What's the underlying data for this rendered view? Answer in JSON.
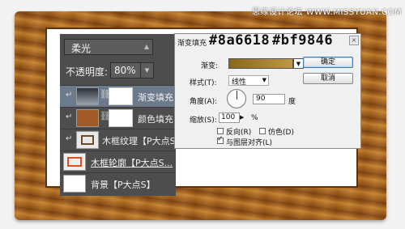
{
  "watermark": "思缘设计论坛 WWW.MISSYUAN.COM",
  "layers_panel": {
    "blend_mode": "柔光",
    "opacity_label": "不透明度:",
    "opacity_value": "80%",
    "layers": [
      {
        "name": "渐变填充 ...",
        "clipped": true,
        "selected": true,
        "thumb": "gradient"
      },
      {
        "name": "颜色填充 ...",
        "clipped": true,
        "selected": false,
        "thumb": "color",
        "fill_color": "#a05a28"
      },
      {
        "name": "木框纹理【P大点S...",
        "clipped": true,
        "selected": false,
        "thumb": "texture"
      },
      {
        "name": "木框轮廓【P大点S...",
        "clipped": false,
        "selected": false,
        "thumb": "outline"
      },
      {
        "name": "背景【P大点S】",
        "clipped": false,
        "selected": false,
        "thumb": "background"
      }
    ]
  },
  "dialog": {
    "title": "渐变填充",
    "hex_start": "#8a6618",
    "hex_end": "#bf9846",
    "gradient_label": "渐变:",
    "style_label": "样式(T):",
    "style_value": "线性",
    "angle_label": "角度(A):",
    "angle_value": "90",
    "angle_unit": "度",
    "scale_label": "缩放(S):",
    "scale_value": "100",
    "scale_unit": "%",
    "reverse_label": "反向(R)",
    "dither_label": "仿色(D)",
    "align_label": "与图层对齐(L)",
    "reverse_checked": false,
    "dither_checked": false,
    "align_checked": true,
    "ok_label": "确定",
    "cancel_label": "取消",
    "gradient_colors": [
      "#8a6618",
      "#bf9846"
    ]
  }
}
